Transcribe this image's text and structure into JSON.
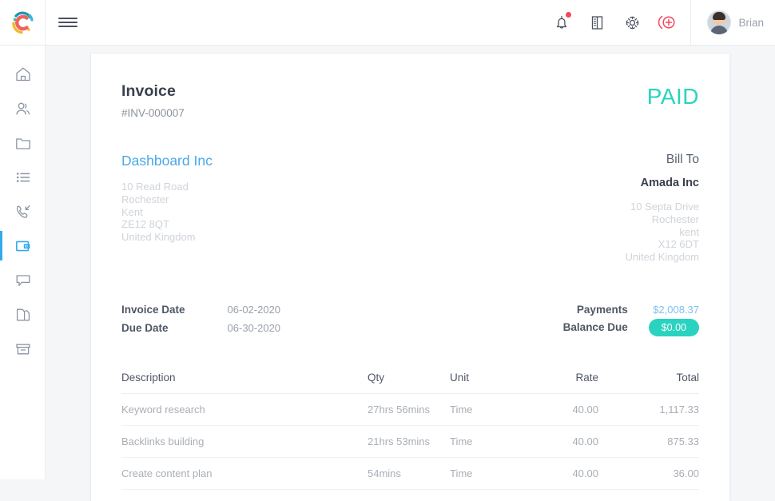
{
  "topbar": {
    "logo": "app-logo-c",
    "menu_toggle": "hamburger-menu",
    "icons": [
      {
        "name": "notifications-bell-icon",
        "label": "Notifications",
        "has_badge": true
      },
      {
        "name": "notes-book-icon",
        "label": "Notes"
      },
      {
        "name": "settings-gear-icon",
        "label": "Settings"
      },
      {
        "name": "add-circle-icon",
        "label": "Add",
        "color": "#f2485b"
      }
    ],
    "user": {
      "name": "Brian",
      "avatar": "user-avatar"
    }
  },
  "sidebar": {
    "items": [
      {
        "name": "home-icon",
        "label": "Home",
        "active": false
      },
      {
        "name": "contacts-icon",
        "label": "Contacts",
        "active": false
      },
      {
        "name": "folder-icon",
        "label": "Projects",
        "active": false
      },
      {
        "name": "list-icon",
        "label": "Tasks",
        "active": false
      },
      {
        "name": "phone-incoming-icon",
        "label": "Calls",
        "active": false
      },
      {
        "name": "wallet-invoice-icon",
        "label": "Invoices",
        "active": true
      },
      {
        "name": "chat-icon",
        "label": "Messages",
        "active": false
      },
      {
        "name": "documents-icon",
        "label": "Documents",
        "active": false
      },
      {
        "name": "archive-box-icon",
        "label": "Archive",
        "active": false
      }
    ],
    "active_color": "#33aaee"
  },
  "invoice": {
    "title": "Invoice",
    "number": "#INV-000007",
    "status": "PAID",
    "status_color": "#2ad3c0",
    "from": {
      "company": "Dashboard Inc",
      "company_color": "#4aa8e8",
      "address": [
        "10 Read Road",
        "Rochester",
        "Kent",
        "ZE12 8QT",
        "United Kingdom"
      ]
    },
    "bill_to": {
      "label": "Bill To",
      "company": "Amada Inc",
      "address": [
        "10 Septa Drive",
        "Rochester",
        "kent",
        "X12 6DT",
        "United Kingdom"
      ]
    },
    "meta": {
      "invoice_date_label": "Invoice Date",
      "invoice_date": "06-02-2020",
      "due_date_label": "Due Date",
      "due_date": "06-30-2020",
      "payments_label": "Payments",
      "payments_value": "$2,008.37",
      "payments_color": "#7ec2ef",
      "balance_label": "Balance Due",
      "balance_value": "$0.00",
      "balance_badge_color": "#2ad3c0"
    },
    "table": {
      "headers": {
        "description": "Description",
        "qty": "Qty",
        "unit": "Unit",
        "rate": "Rate",
        "total": "Total"
      },
      "rows": [
        {
          "description": "Keyword research",
          "qty": "27hrs  56mins",
          "unit": "Time",
          "rate": "40.00",
          "total": "1,117.33"
        },
        {
          "description": "Backlinks building",
          "qty": "21hrs  53mins",
          "unit": "Time",
          "rate": "40.00",
          "total": "875.33"
        },
        {
          "description": "Create content plan",
          "qty": "54mins",
          "unit": "Time",
          "rate": "40.00",
          "total": "36.00"
        }
      ]
    }
  }
}
